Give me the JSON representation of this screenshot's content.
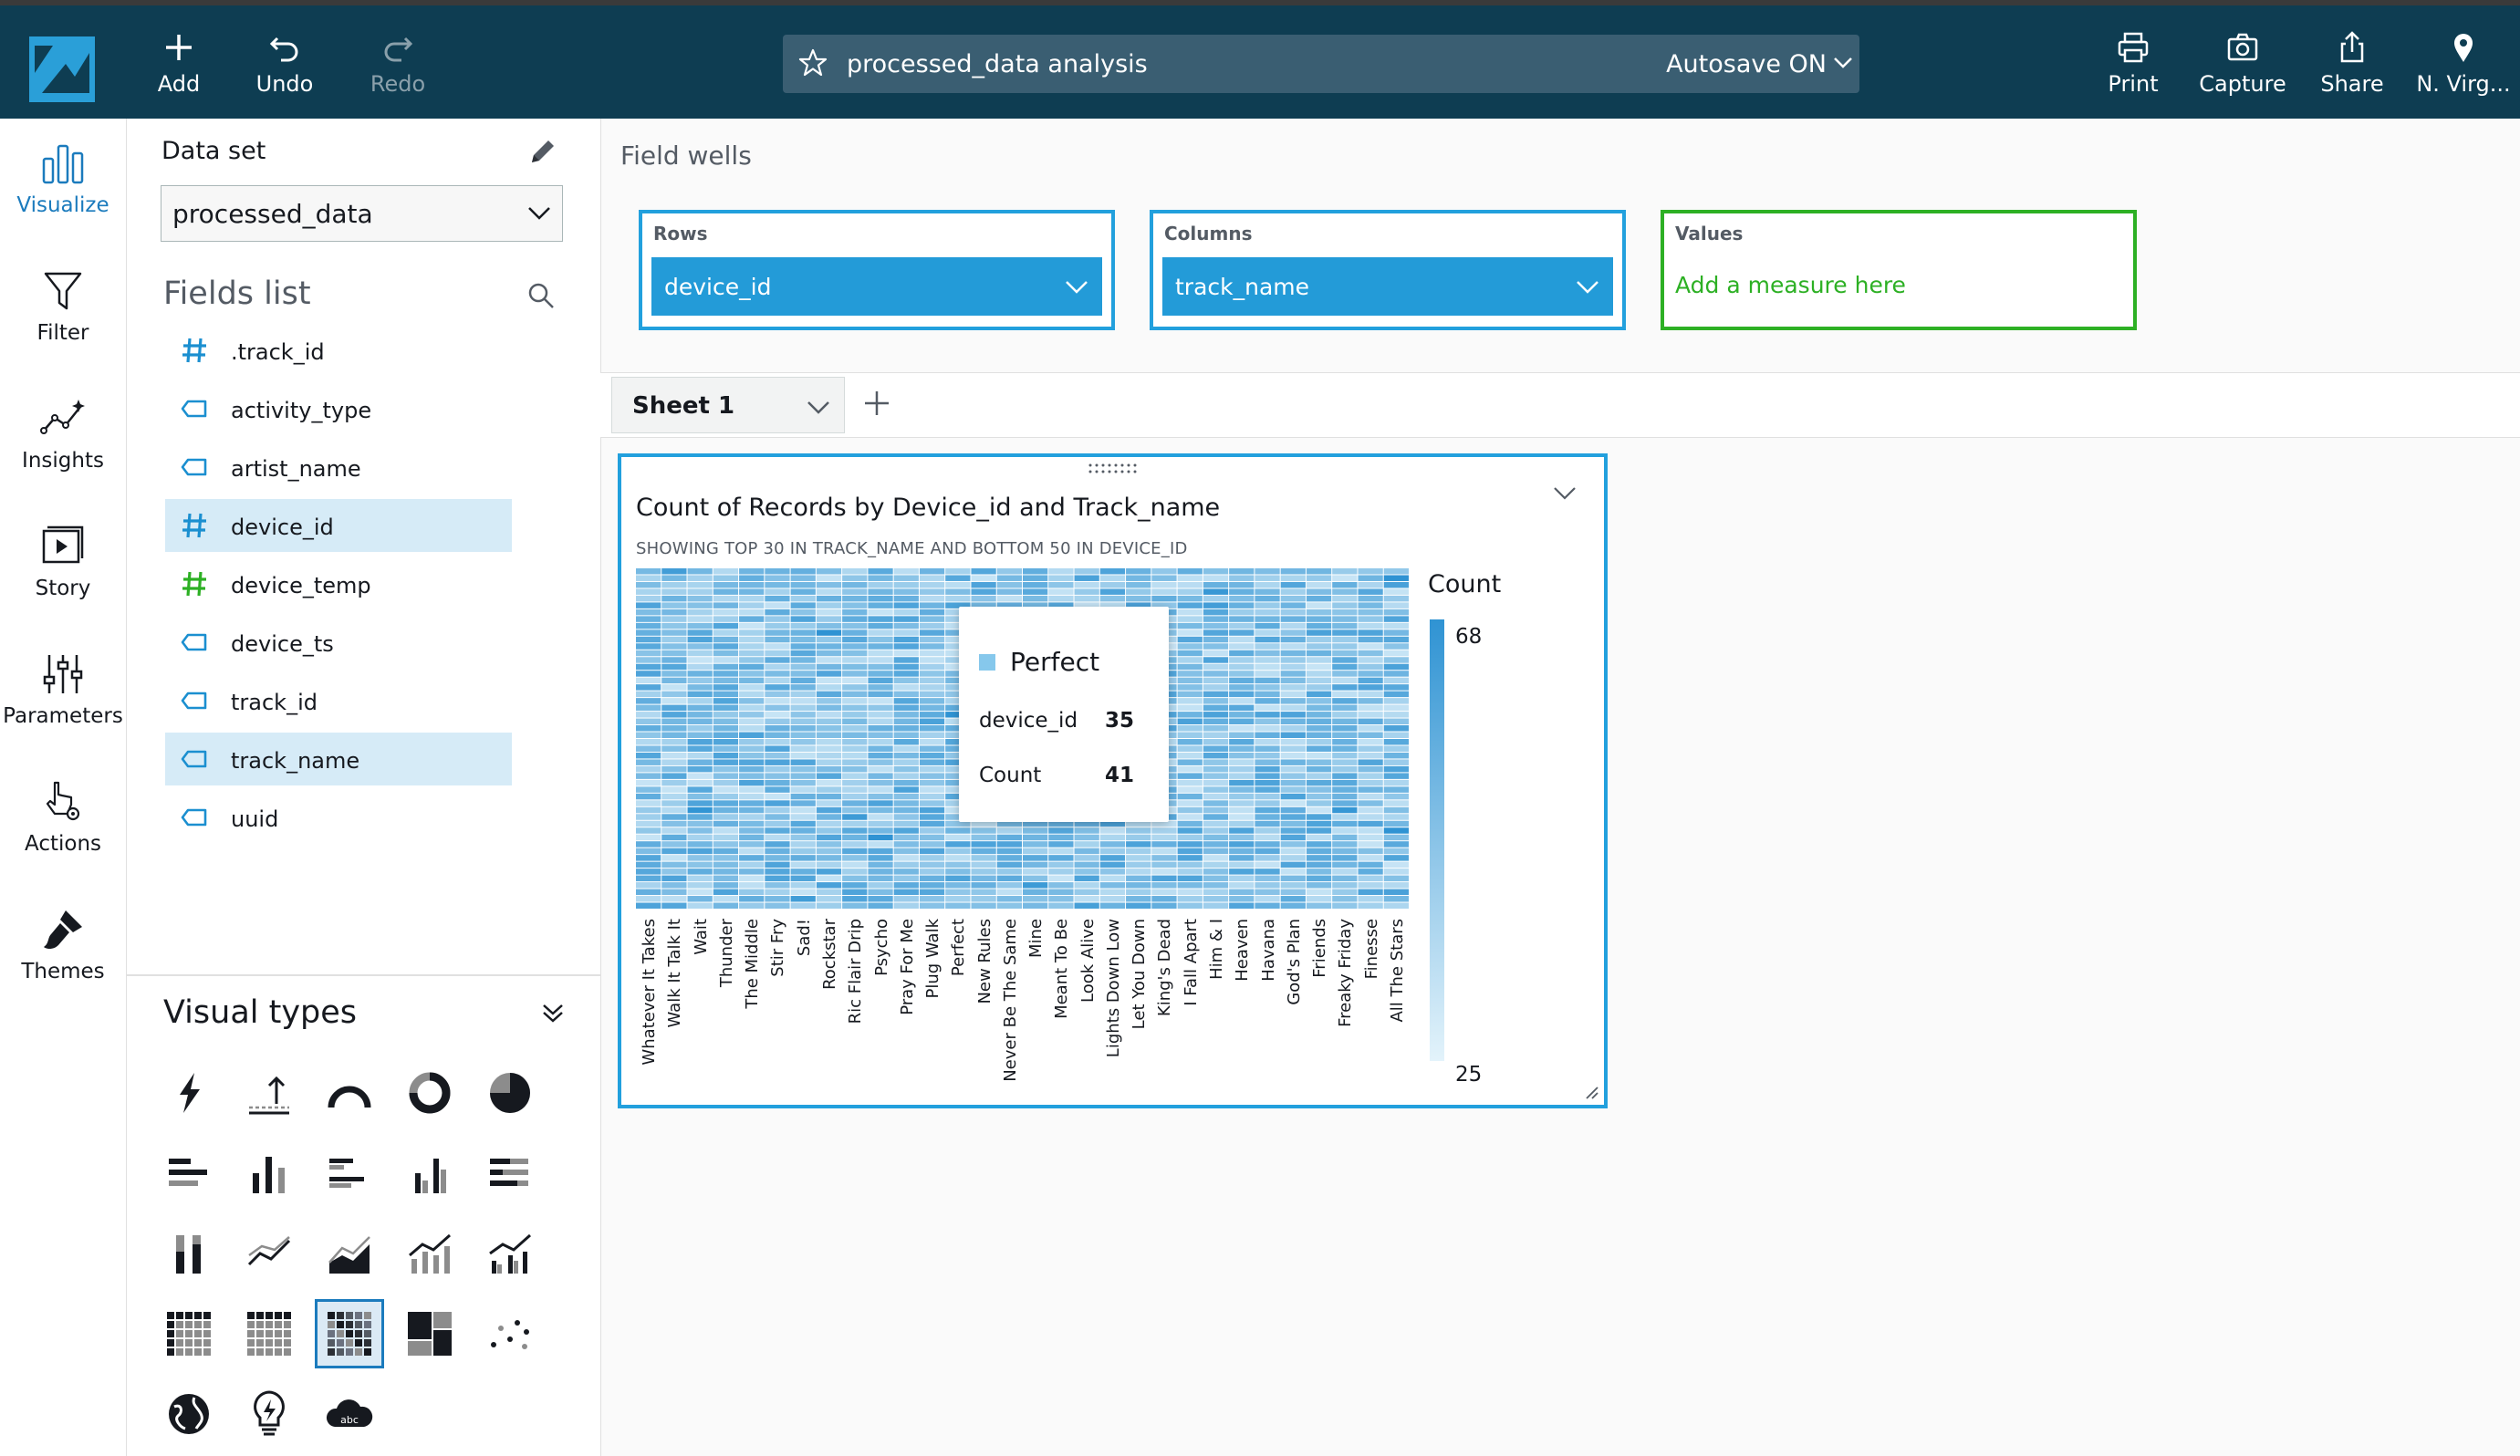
{
  "toolbar": {
    "add": "Add",
    "undo": "Undo",
    "redo": "Redo",
    "analysis_title": "processed_data analysis",
    "autosave": "Autosave ON",
    "print": "Print",
    "capture": "Capture",
    "share": "Share",
    "region": "N. Virg..."
  },
  "nav": {
    "visualize": "Visualize",
    "filter": "Filter",
    "insights": "Insights",
    "story": "Story",
    "parameters": "Parameters",
    "actions": "Actions",
    "themes": "Themes"
  },
  "dataset": {
    "label": "Data set",
    "selected": "processed_data"
  },
  "fields_list": {
    "title": "Fields list",
    "fields": [
      {
        "name": ".track_id",
        "type": "number",
        "selected": false
      },
      {
        "name": "activity_type",
        "type": "string",
        "selected": false
      },
      {
        "name": "artist_name",
        "type": "string",
        "selected": false
      },
      {
        "name": "device_id",
        "type": "number",
        "selected": true
      },
      {
        "name": "device_temp",
        "type": "number-measure",
        "selected": false
      },
      {
        "name": "device_ts",
        "type": "string",
        "selected": false
      },
      {
        "name": "track_id",
        "type": "string",
        "selected": false
      },
      {
        "name": "track_name",
        "type": "string",
        "selected": true
      },
      {
        "name": "uuid",
        "type": "string",
        "selected": false
      }
    ]
  },
  "visual_types": {
    "title": "Visual types",
    "icons": [
      "kpi-icon",
      "gauge-arrow-icon",
      "arc-gauge-icon",
      "donut-icon",
      "pie-icon",
      "horizontal-bar-icon",
      "vertical-bar-icon",
      "clustered-horizontal-bar-icon",
      "clustered-vertical-bar-icon",
      "stacked-horizontal-bar-icon",
      "stacked-vertical-bar-icon",
      "line-icon",
      "area-icon",
      "combo-line-bar-icon",
      "combo-line-clustered-icon",
      "pivot-table-icon",
      "table-icon",
      "heat-map-icon",
      "tree-map-icon",
      "scatter-icon",
      "geo-map-icon",
      "insight-icon",
      "word-cloud-icon"
    ],
    "active": "heat-map-icon",
    "word_cloud_text": "abc"
  },
  "field_wells": {
    "title": "Field wells",
    "rows_label": "Rows",
    "rows_value": "device_id",
    "columns_label": "Columns",
    "columns_value": "track_name",
    "values_label": "Values",
    "values_placeholder": "Add a measure here"
  },
  "sheet": {
    "tab_label": "Sheet 1"
  },
  "visual": {
    "title": "Count of Records by Device_id and Track_name",
    "subtitle": "SHOWING TOP 30 IN TRACK_NAME AND BOTTOM 50 IN DEVICE_ID",
    "legend_title": "Count",
    "legend_max": "68",
    "legend_min": "25",
    "tooltip": {
      "title": "Perfect",
      "row1_key": "device_id",
      "row1_value": "35",
      "row2_key": "Count",
      "row2_value": "41"
    }
  },
  "chart_data": {
    "type": "heatmap",
    "title": "Count of Records by Device_id and Track_name",
    "x_categories": [
      "Whatever It Takes",
      "Walk It Talk It",
      "Wait",
      "Thunder",
      "The Middle",
      "Stir Fry",
      "Sad!",
      "Rockstar",
      "Ric Flair Drip",
      "Psycho",
      "Pray For Me",
      "Plug Walk",
      "Perfect",
      "New Rules",
      "Never Be The Same",
      "Mine",
      "Meant To Be",
      "Look Alive",
      "Lights Down Low",
      "Let You Down",
      "King's Dead",
      "I Fall Apart",
      "Him & I",
      "Heaven",
      "Havana",
      "God's Plan",
      "Friends",
      "Freaky Friday",
      "Finesse",
      "All The Stars"
    ],
    "rows": 50,
    "color_scale": {
      "min": 25,
      "max": 68,
      "low_color": "#e3f3fb",
      "high_color": "#2f93d3"
    },
    "highlighted_cell": {
      "track_name": "Perfect",
      "device_id": 35,
      "count": 41
    }
  }
}
